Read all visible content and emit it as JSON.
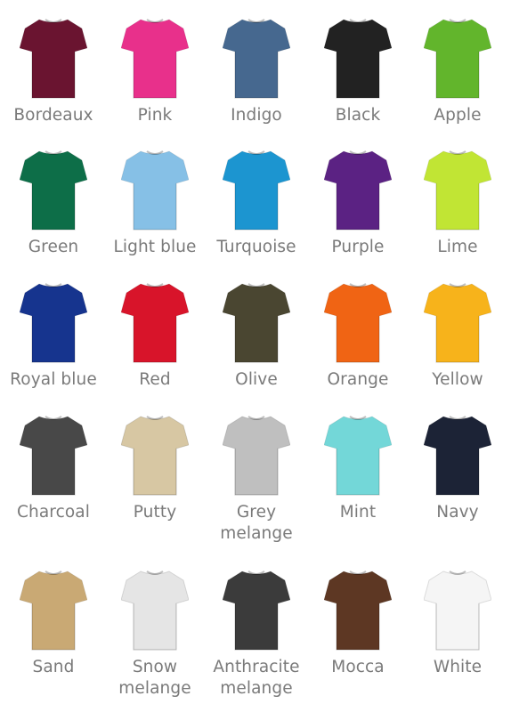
{
  "colors": [
    {
      "label": "Bordeaux",
      "hex": "#6a1430"
    },
    {
      "label": "Pink",
      "hex": "#e8308b"
    },
    {
      "label": "Indigo",
      "hex": "#46688f"
    },
    {
      "label": "Black",
      "hex": "#222222"
    },
    {
      "label": "Apple",
      "hex": "#62b52c"
    },
    {
      "label": "Green",
      "hex": "#0d6e48"
    },
    {
      "label": "Light blue",
      "hex": "#86c0e6"
    },
    {
      "label": "Turquoise",
      "hex": "#1c95d0"
    },
    {
      "label": "Purple",
      "hex": "#5b2283"
    },
    {
      "label": "Lime",
      "hex": "#c1e534"
    },
    {
      "label": "Royal blue",
      "hex": "#16348e"
    },
    {
      "label": "Red",
      "hex": "#d8142a"
    },
    {
      "label": "Olive",
      "hex": "#4a4631"
    },
    {
      "label": "Orange",
      "hex": "#f06414"
    },
    {
      "label": "Yellow",
      "hex": "#f7b31b"
    },
    {
      "label": "Charcoal",
      "hex": "#484848"
    },
    {
      "label": "Putty",
      "hex": "#d7c7a3"
    },
    {
      "label": "Grey melange",
      "hex": "#bfbfbf"
    },
    {
      "label": "Mint",
      "hex": "#73d7d8"
    },
    {
      "label": "Navy",
      "hex": "#1c2336"
    },
    {
      "label": "Sand",
      "hex": "#c9a974"
    },
    {
      "label": "Snow melange",
      "hex": "#e5e5e5"
    },
    {
      "label": "Anthracite melange",
      "hex": "#3b3b3b"
    },
    {
      "label": "Mocca",
      "hex": "#5d3723"
    },
    {
      "label": "White",
      "hex": "#f5f5f5"
    }
  ]
}
